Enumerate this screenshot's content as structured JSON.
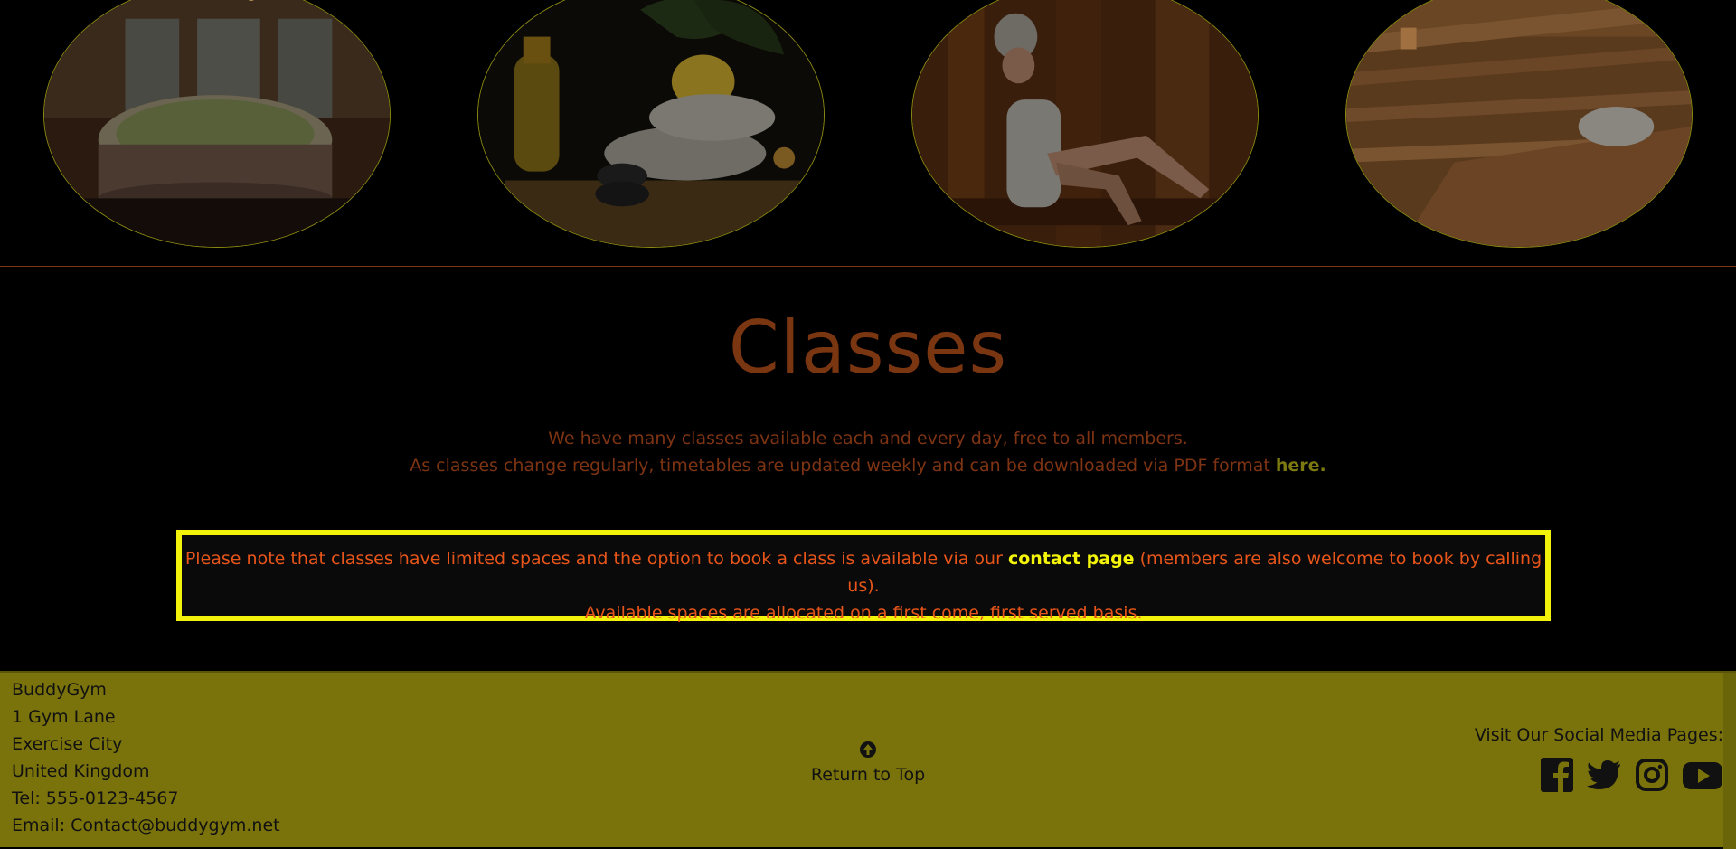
{
  "gallery": {
    "images": [
      {
        "subject": "hot tub in wooden spa room"
      },
      {
        "subject": "oil bottle, flower, towel and stones"
      },
      {
        "subject": "woman relaxing in sauna"
      },
      {
        "subject": "wooden sauna interior with towel"
      }
    ]
  },
  "classes": {
    "title": "Classes",
    "intro_line1": "We have many classes available each and every day, free to all members.",
    "intro_line2": "As classes change regularly, timetables are updated weekly and can be downloaded via PDF format",
    "here_link": "here."
  },
  "notice": {
    "text_before": "Please note that classes have limited spaces and the option to book a class is available via our",
    "contact_link": "contact page",
    "text_after": "(members are also welcome to book by calling us).",
    "line2": "Available spaces are allocated on a first come, first served basis."
  },
  "footer": {
    "address": {
      "name": "BuddyGym",
      "street": "1 Gym Lane",
      "city": "Exercise City",
      "country": "United Kingdom",
      "tel": "Tel: 555-0123-4567",
      "email": "Email: Contact@buddygym.net"
    },
    "return_to_top": "Return to Top",
    "social_title": "Visit Our Social Media Pages:",
    "social_icons": [
      "facebook-icon",
      "twitter-icon",
      "instagram-icon",
      "youtube-icon"
    ]
  },
  "colors": {
    "heading": "#7a3511",
    "notice_border": "#f2f20a",
    "notice_text": "#e8551a",
    "footer_bg": "#7a730c"
  }
}
